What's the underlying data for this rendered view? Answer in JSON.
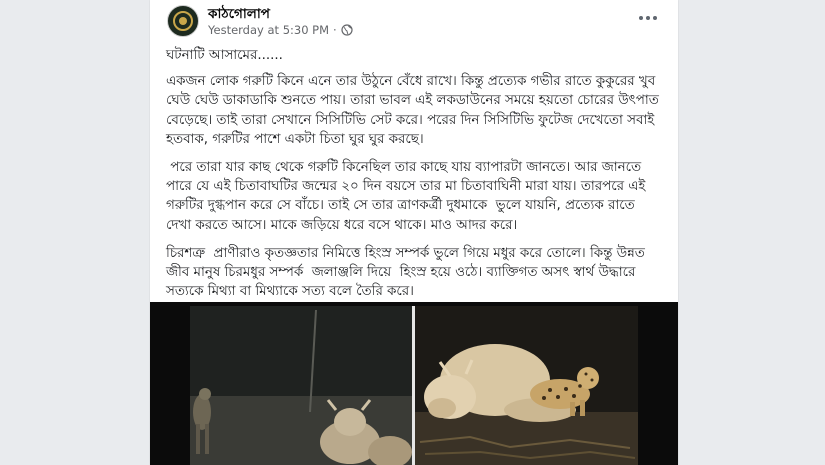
{
  "post": {
    "page_name": "কাঠগোলাপ",
    "timestamp": "Yesterday at 5:30 PM",
    "separator": "·",
    "privacy_icon": "globe-icon",
    "menu_icon": "more-options-icon",
    "paragraphs": [
      "ঘটনাটি আসামের......",
      "একজন লোক গরুটি কিনে এনে তার উঠুনে বেঁধে রাখে। কিন্তু প্রত্যেক গভীর রাতে কুকুরের খুব ঘেউ ঘেউ ডাকাডাকি শুনতে পায়। তারা ভাবল এই লকডাউনের সময়ে হয়তো চোরের উৎপাত বেড়েছে। তাই তারা সেখানে সিসিটিভি সেট করে। পরের দিন সিসিটিভি ফুটেজ দেখেতো সবাই হতবাক, গরুটির পাশে একটা চিতা ঘুর ঘুর করছে।",
      " পরে তারা যার কাছ থেকে গরুটি কিনেছিল তার কাছে যায় ব্যাপারটা জানতে। আর জানতে পারে যে এই চিতাবাঘটির জন্মের ২০ দিন বয়সে তার মা চিতাবাঘিনী মারা যায়। তারপরে এই গরুটির দুগ্ধপান করে সে বাঁচে। তাই সে তার ত্রাণকর্ত্রী দুধমাকে  ভুলে যায়নি, প্রত্যেক রাতে দেখা করতে আসে। মাকে জড়িয়ে ধরে বসে থাকে। মাও আদর করে।",
      "চিরশত্রু  প্রাণীরাও কৃতজ্ঞতার নিমিত্তে হিংস্র সম্পর্ক ভুলে গিয়ে মধুর করে তোলে। কিন্তু উন্নত জীব মানুষ চিরমধুর সম্পর্ক  জলাঞ্জলি দিয়ে  হিংস্র হয়ে ওঠে। ব্যাক্তিগত অসৎ স্বার্থ উদ্ধারে সত্যকে মিথ্যা বা মিথ্যাকে সত্য বলে তৈরি করে।"
    ],
    "photo_left_desc": "cctv-night-leopard-cow",
    "photo_right_desc": "leopard-resting-with-cow"
  },
  "colors": {
    "page_bg": "#e9ebee",
    "card_bg": "#ffffff",
    "text": "#1c1e21",
    "meta": "#65676b"
  }
}
